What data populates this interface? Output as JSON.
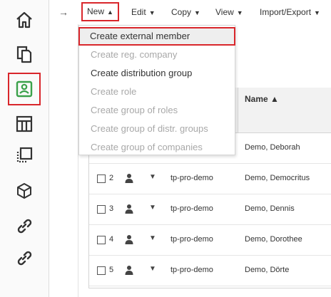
{
  "toolbar": {
    "back": "→",
    "new": "New",
    "edit": "Edit",
    "copy": "Copy",
    "view": "View",
    "import_export": "Import/Export",
    "caret_up": "▲",
    "caret_down": "▼"
  },
  "sidebar": {
    "items": [
      {
        "icon": "home-icon"
      },
      {
        "icon": "documents-icon"
      },
      {
        "icon": "contact-card-icon",
        "active": true
      },
      {
        "icon": "table-layout-icon"
      },
      {
        "icon": "selection-icon"
      },
      {
        "icon": "cube-icon"
      },
      {
        "icon": "link-icon"
      },
      {
        "icon": "link-icon"
      }
    ]
  },
  "menu": {
    "items": [
      {
        "label": "Create external member",
        "state": "highlighted"
      },
      {
        "label": "Create reg. company",
        "state": "disabled"
      },
      {
        "label": "Create distribution group",
        "state": "enabled"
      },
      {
        "label": "Create role",
        "state": "disabled"
      },
      {
        "label": "Create group of roles",
        "state": "disabled"
      },
      {
        "label": "Create group of distr. groups",
        "state": "disabled"
      },
      {
        "label": "Create group of companies",
        "state": "disabled"
      }
    ]
  },
  "grid": {
    "name_header": "Name ▲",
    "rows": [
      {
        "num": "",
        "tenant": "",
        "name": "Demo, Deborah"
      },
      {
        "num": "2",
        "tenant": "tp-pro-demo",
        "name": "Demo, Democritus"
      },
      {
        "num": "3",
        "tenant": "tp-pro-demo",
        "name": "Demo, Dennis"
      },
      {
        "num": "4",
        "tenant": "tp-pro-demo",
        "name": "Demo, Dorothee"
      },
      {
        "num": "5",
        "tenant": "tp-pro-demo",
        "name": "Demo, Dörte"
      }
    ]
  },
  "colors": {
    "highlight_border": "#d9262b",
    "active_icon": "#3aa14a",
    "disabled_text": "#a8a8a8"
  }
}
